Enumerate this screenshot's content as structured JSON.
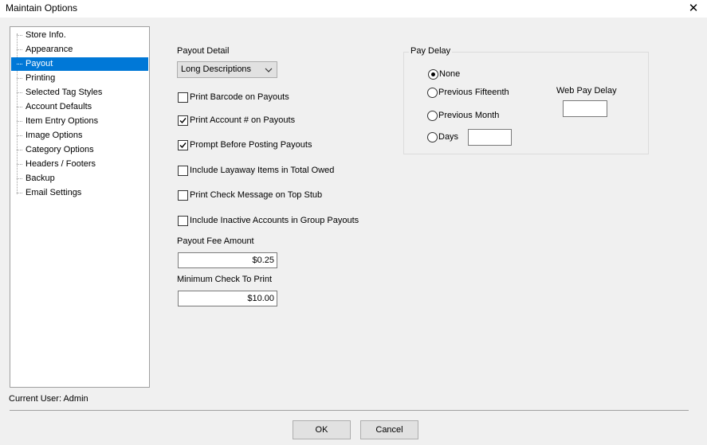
{
  "window": {
    "title": "Maintain Options",
    "close_glyph": "✕"
  },
  "sidebar": {
    "items": [
      {
        "label": "Store Info.",
        "selected": false
      },
      {
        "label": "Appearance",
        "selected": false
      },
      {
        "label": "Payout",
        "selected": true
      },
      {
        "label": "Printing",
        "selected": false
      },
      {
        "label": "Selected Tag Styles",
        "selected": false
      },
      {
        "label": "Account Defaults",
        "selected": false
      },
      {
        "label": "Item Entry Options",
        "selected": false
      },
      {
        "label": "Image Options",
        "selected": false
      },
      {
        "label": "Category Options",
        "selected": false
      },
      {
        "label": "Headers / Footers",
        "selected": false
      },
      {
        "label": "Backup",
        "selected": false
      },
      {
        "label": "Email Settings",
        "selected": false
      }
    ]
  },
  "payout": {
    "detail_label": "Payout Detail",
    "detail_value": "Long Descriptions",
    "checkboxes": [
      {
        "label": "Print Barcode on Payouts",
        "checked": false
      },
      {
        "label": "Print Account # on Payouts",
        "checked": true
      },
      {
        "label": "Prompt Before Posting Payouts",
        "checked": true
      },
      {
        "label": "Include Layaway Items in Total Owed",
        "checked": false
      },
      {
        "label": "Print Check Message on Top Stub",
        "checked": false
      },
      {
        "label": "Include Inactive Accounts in Group Payouts",
        "checked": false
      }
    ],
    "fee_label": "Payout Fee Amount",
    "fee_value": "$0.25",
    "min_check_label": "Minimum Check To Print",
    "min_check_value": "$10.00"
  },
  "pay_delay": {
    "title": "Pay Delay",
    "options": [
      {
        "label": "None",
        "selected": true
      },
      {
        "label": "Previous Fifteenth",
        "selected": false
      },
      {
        "label": "Previous Month",
        "selected": false
      },
      {
        "label": "Days",
        "selected": false
      }
    ],
    "days_value": "",
    "web_label": "Web Pay Delay",
    "web_value": ""
  },
  "footer": {
    "current_user": "Current User: Admin",
    "ok_label": "OK",
    "cancel_label": "Cancel"
  },
  "colors": {
    "selection": "#0078d7",
    "background": "#f0f0f0"
  }
}
